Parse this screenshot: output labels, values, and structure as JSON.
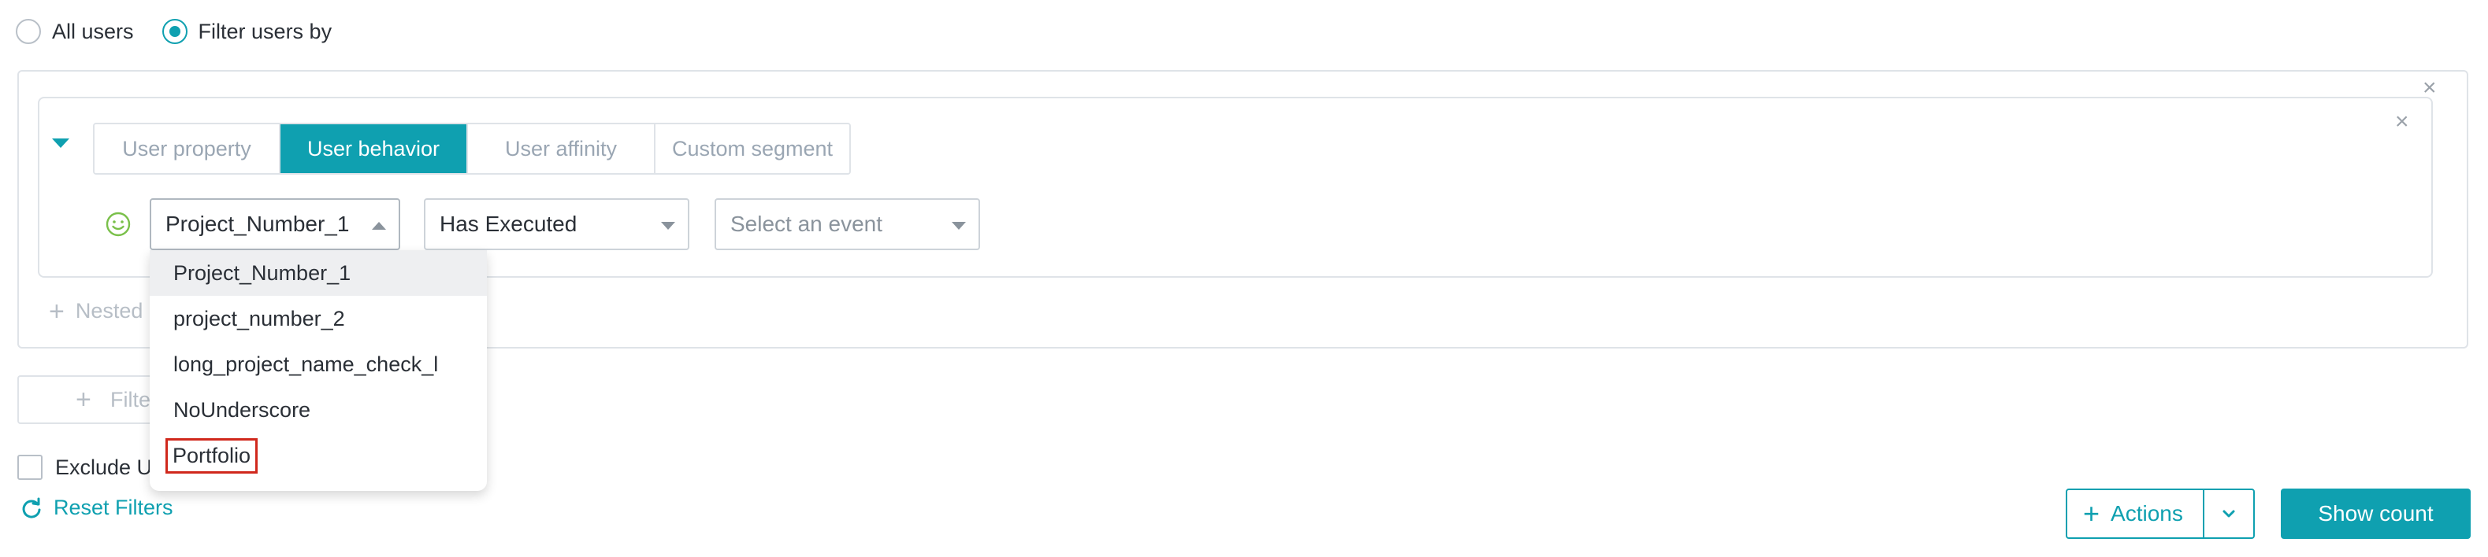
{
  "audience": {
    "all_users_label": "All users",
    "filter_users_label": "Filter users by"
  },
  "filter": {
    "tabs": [
      {
        "label": "User property"
      },
      {
        "label": "User behavior"
      },
      {
        "label": "User affinity"
      },
      {
        "label": "Custom segment"
      }
    ],
    "active_tab": "User behavior",
    "project_select": {
      "value": "Project_Number_1"
    },
    "action_select": {
      "value": "Has Executed"
    },
    "event_select": {
      "placeholder": "Select an event"
    },
    "dropdown_options": [
      {
        "label": "Project_Number_1"
      },
      {
        "label": "project_number_2"
      },
      {
        "label": "long_project_name_check_l"
      },
      {
        "label": "NoUnderscore"
      },
      {
        "label": "Portfolio"
      }
    ],
    "nested_label": "Nested",
    "add_filter_label": "Filter"
  },
  "footer": {
    "exclude_label": "Exclude U",
    "reset_label": "Reset Filters",
    "actions_label": "Actions",
    "show_count_label": "Show count"
  },
  "colors": {
    "accent": "#0fa0b0",
    "highlight_box": "#d0281c"
  },
  "icons": {
    "close": "close-icon",
    "caret": "caret-down-icon",
    "smiley": "smiley-icon",
    "plus": "plus-icon",
    "refresh": "refresh-icon",
    "chevron": "chevron-down-icon"
  }
}
